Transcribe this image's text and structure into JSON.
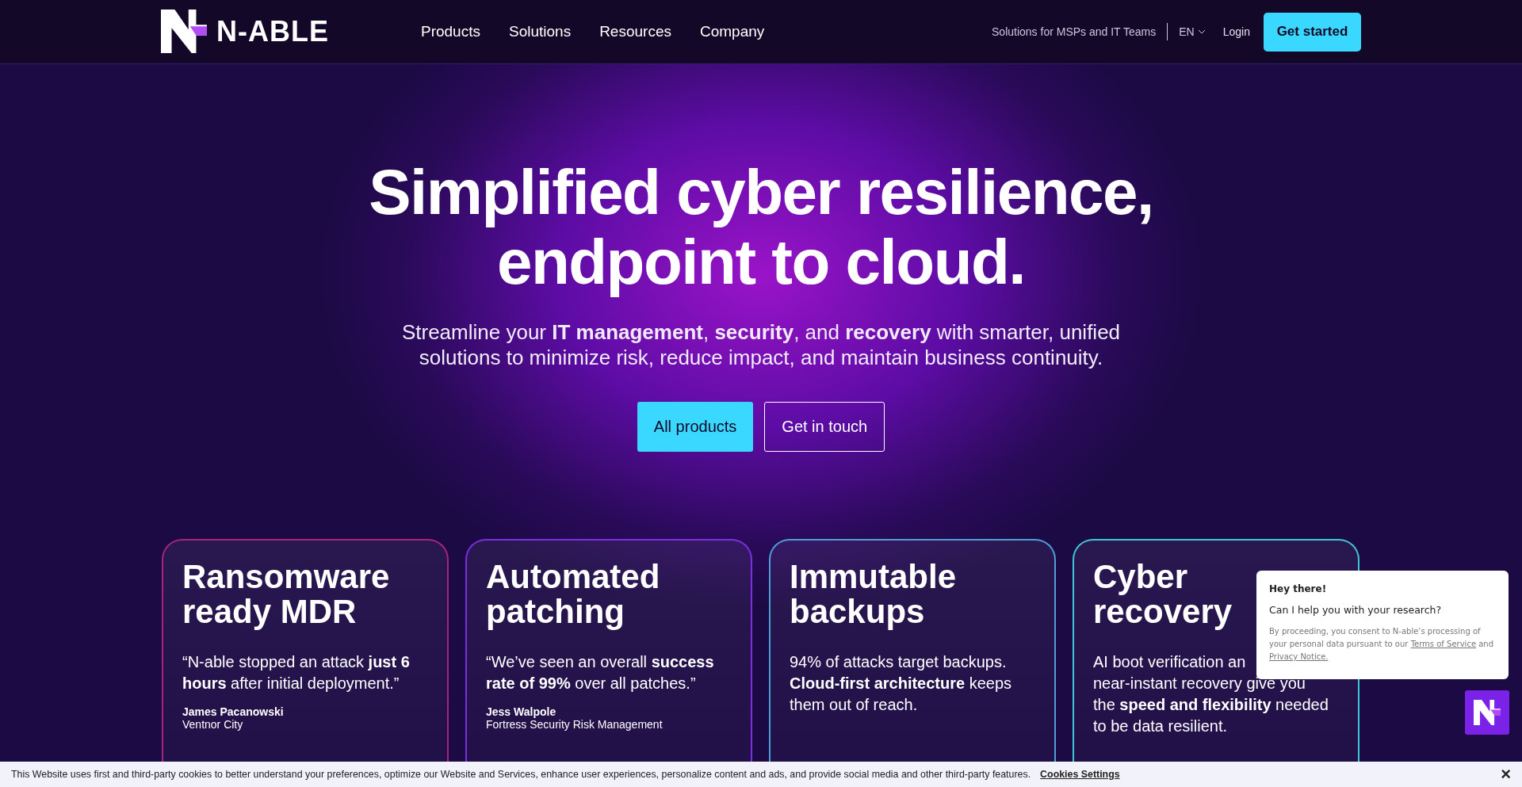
{
  "header": {
    "logo": "N-ABLE",
    "nav": [
      "Products",
      "Solutions",
      "Resources",
      "Company"
    ],
    "tagline": "Solutions for MSPs and IT Teams",
    "language": "EN",
    "login": "Login",
    "cta": "Get started"
  },
  "hero": {
    "title_lines": [
      "Simplified cyber resilience,",
      "endpoint to cloud."
    ],
    "subtitle_lines": [
      "Streamline your **IT management**, **security**, and **recovery** with smarter, unified",
      "solutions to minimize risk, reduce impact, and maintain business continuity."
    ],
    "buttons": [
      {
        "label": "All products",
        "kind": "primary"
      },
      {
        "label": "Get in touch",
        "kind": "outline"
      }
    ]
  },
  "cards": [
    {
      "title_lines": [
        "Ransomware",
        "ready MDR"
      ],
      "body_lines": [
        "“N-able stopped an attack **just 6**",
        "**hours** after initial deployment.”"
      ],
      "author": "James Pacanowski",
      "org": "Ventnor City",
      "color": "#a8237f"
    },
    {
      "title_lines": [
        "Automated",
        "patching"
      ],
      "body_lines": [
        "“We’ve seen an overall **success**",
        "**rate of 99%** over all patches.”"
      ],
      "author": "Jess Walpole",
      "org": "Fortress Security Risk Management",
      "color": "#7b2fe0"
    },
    {
      "title_lines": [
        "Immutable",
        "backups"
      ],
      "body_lines": [
        "94% of attacks target backups.",
        "**Cloud-first architecture** keeps",
        "them out of reach."
      ],
      "color": "#4d9fd6"
    },
    {
      "title_lines": [
        "Cyber",
        "recovery"
      ],
      "body_lines": [
        "AI boot verification an",
        "near-instant recovery give you",
        "the **speed and flexibility** needed",
        "to be data resilient."
      ],
      "color": "#3fc6d6"
    }
  ],
  "chat": {
    "greeting": "Hey there!",
    "question": "Can I help you with your research?",
    "consent": "By proceeding, you consent to N-able’s processing of your personal data pursuant to our",
    "terms_link": "Terms of Service",
    "and": "and",
    "privacy_link": "Privacy Notice."
  },
  "cookie_bar": {
    "text": "This Website uses first and third-party cookies to better understand your preferences, optimize our Website and Services, enhance user experiences, personalize content and ads, and provide social media and other third-party features.",
    "settings_link": "Cookies Settings",
    "close": "×"
  }
}
